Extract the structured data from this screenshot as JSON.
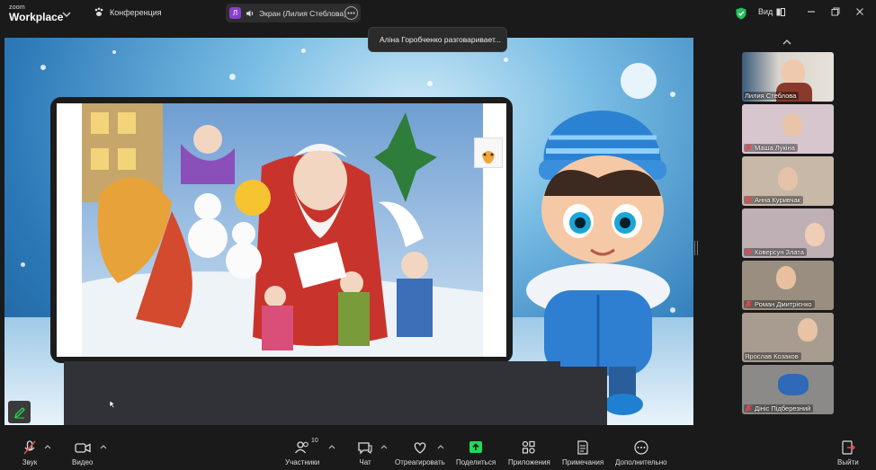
{
  "app": {
    "brand_top": "zoom",
    "brand_bottom": "Workplace"
  },
  "topbar": {
    "conference_label": "Конференция",
    "screen_share_avatar": "Л",
    "screen_share_label": "Экран (Лилия Стеблова)",
    "view_label": "Вид"
  },
  "toast": {
    "text": "Аліна  Горобченко разговаривает..."
  },
  "participants": [
    {
      "name": "Лилия Стеблова",
      "muted": false
    },
    {
      "name": "Маша Лукіна",
      "muted": true
    },
    {
      "name": "Анна Куривчак",
      "muted": true
    },
    {
      "name": "Коверсун Злата",
      "muted": true
    },
    {
      "name": "Роман Дмитрієнко",
      "muted": true
    },
    {
      "name": "Ярослав  Козаков",
      "muted": false
    },
    {
      "name": "Дініс Підберезний",
      "muted": true
    }
  ],
  "toolbar": {
    "audio_label": "Звук",
    "video_label": "Видео",
    "participants_label": "Участники",
    "participants_count": "10",
    "chat_label": "Чат",
    "react_label": "Отреагировать",
    "share_label": "Поделиться",
    "apps_label": "Приложения",
    "notes_label": "Примечания",
    "more_label": "Дополнительно",
    "leave_label": "Выйти"
  },
  "colors": {
    "share_accent": "#23d959",
    "muted_red": "#e5484d",
    "avatar_purple": "#8a3fd1"
  }
}
